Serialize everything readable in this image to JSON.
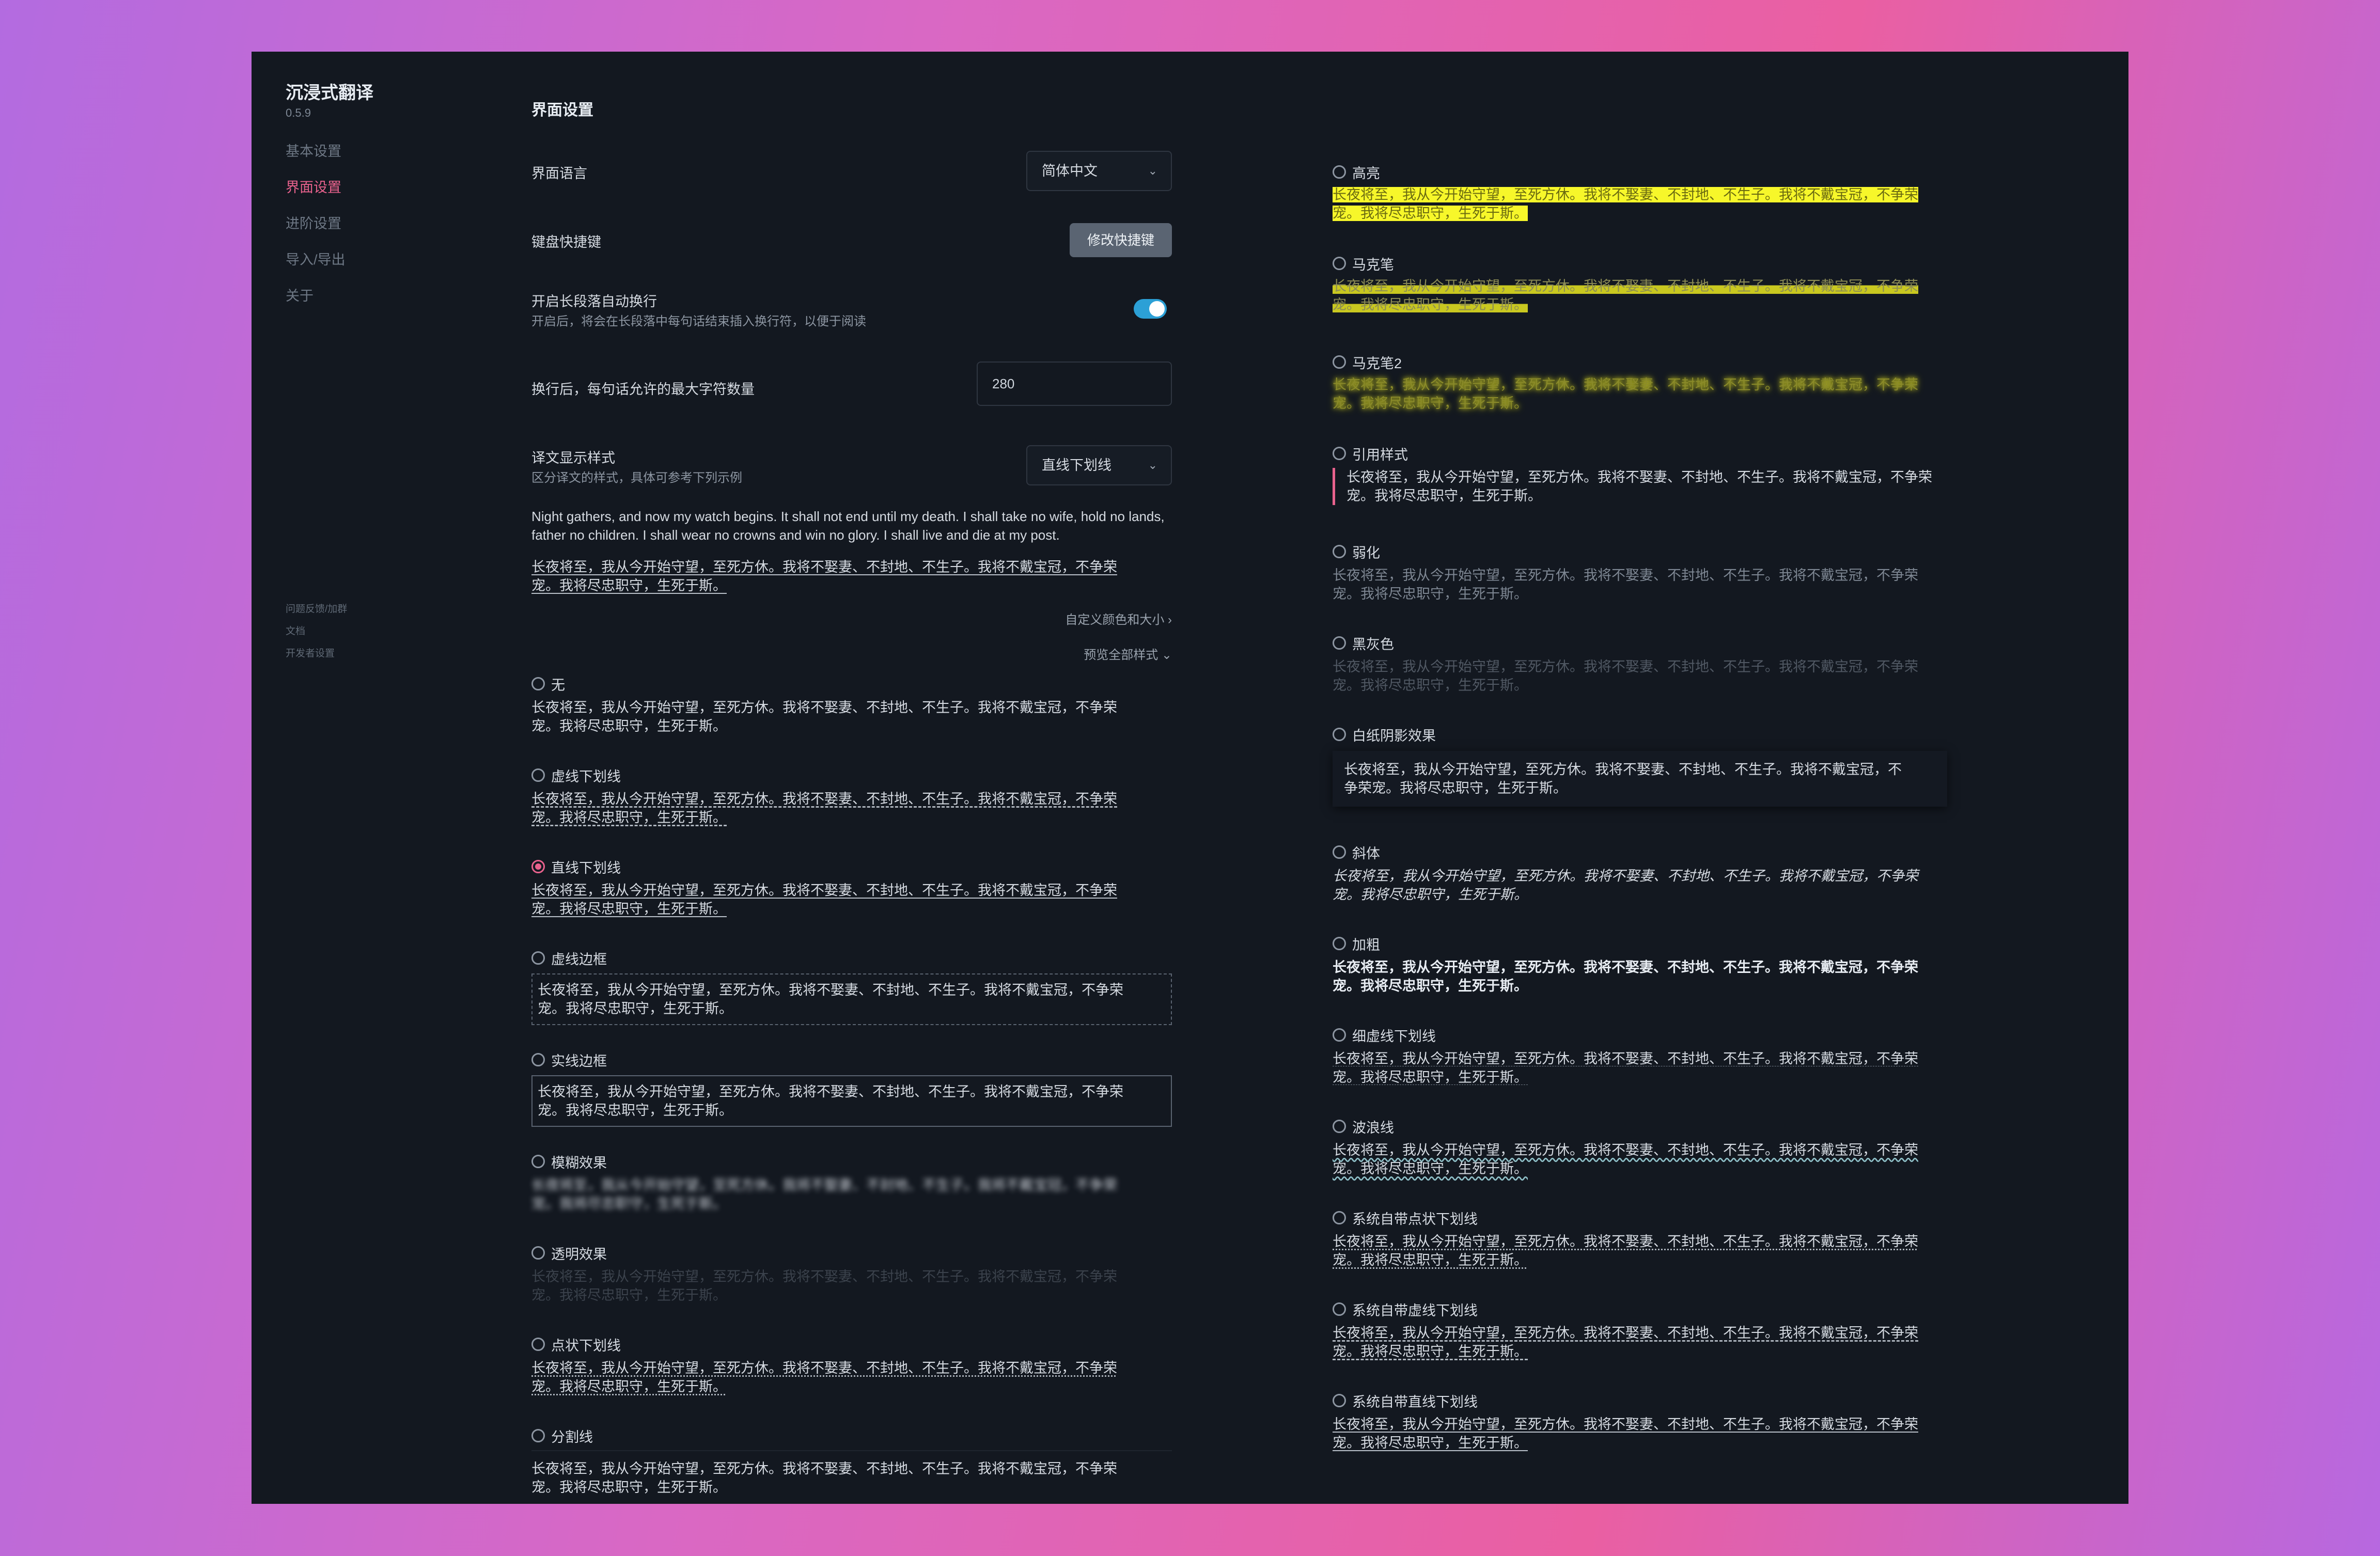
{
  "sidebar": {
    "title": "沉浸式翻译",
    "version": "0.5.9",
    "nav": [
      "基本设置",
      "界面设置",
      "进阶设置",
      "导入/导出",
      "关于"
    ],
    "links": [
      "问题反馈/加群",
      "文档",
      "开发者设置"
    ]
  },
  "settings": {
    "page_title": "界面设置",
    "language_label": "界面语言",
    "language_value": "简体中文",
    "shortcut_label": "键盘快捷键",
    "shortcut_button": "修改快捷键",
    "autobreak_label": "开启长段落自动换行",
    "autobreak_desc": "开启后，将会在长段落中每句话结束插入换行符，以便于阅读",
    "autobreak_on": true,
    "maxchars_label": "换行后，每句话允许的最大字符数量",
    "maxchars_value": "280",
    "style_label": "译文显示样式",
    "style_desc": "区分译文的样式，具体可参考下列示例",
    "style_value": "直线下划线",
    "custom_link": "自定义颜色和大小",
    "preview_link": "预览全部样式"
  },
  "sample": {
    "english": "Night gathers, and now my watch begins. It shall not end until my death. I shall take no wife, hold no lands, father no children. I shall wear no crowns and win no glory. I shall live and die at my post.",
    "chinese_line1": "长夜将至，我从今开始守望，至死方休。我将不娶妻、不封地、不生子。我将不戴宝冠，不争荣",
    "chinese_line2": "宠。我将尽忠职守，生死于斯。",
    "chinese_paper_line1": "长夜将至，我从今开始守望，至死方休。我将不娶妻、不封地、不生子。我将不戴宝冠，不",
    "chinese_paper_line2": "争荣宠。我将尽忠职守，生死于斯。"
  },
  "styles_left": [
    {
      "label": "无",
      "checked": false
    },
    {
      "label": "虚线下划线",
      "checked": false
    },
    {
      "label": "直线下划线",
      "checked": true
    },
    {
      "label": "虚线边框",
      "checked": false
    },
    {
      "label": "实线边框",
      "checked": false
    },
    {
      "label": "模糊效果",
      "checked": false
    },
    {
      "label": "透明效果",
      "checked": false
    },
    {
      "label": "点状下划线",
      "checked": false
    },
    {
      "label": "分割线",
      "checked": false
    }
  ],
  "styles_right": [
    {
      "label": "高亮"
    },
    {
      "label": "马克笔"
    },
    {
      "label": "马克笔2"
    },
    {
      "label": "引用样式"
    },
    {
      "label": "弱化"
    },
    {
      "label": "黑灰色"
    },
    {
      "label": "白纸阴影效果"
    },
    {
      "label": "斜体"
    },
    {
      "label": "加粗"
    },
    {
      "label": "细虚线下划线"
    },
    {
      "label": "波浪线"
    },
    {
      "label": "系统自带点状下划线"
    },
    {
      "label": "系统自带虚线下划线"
    },
    {
      "label": "系统自带直线下划线"
    }
  ],
  "colors": {
    "accent": "#e8628d",
    "toggle": "#2ca0d6",
    "highlight": "#f7f72a",
    "background": "#131820"
  }
}
